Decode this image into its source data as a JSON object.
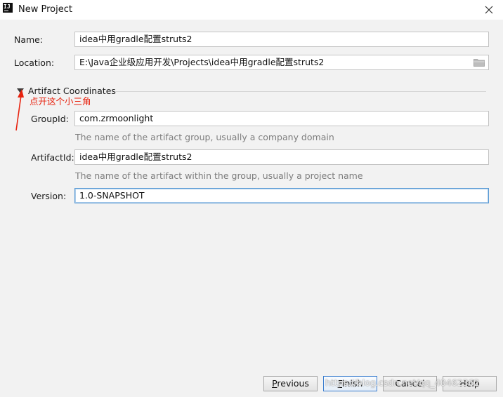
{
  "window": {
    "title": "New Project",
    "app_icon_text": "IJ"
  },
  "name": {
    "label": "Name:",
    "value": "idea中用gradle配置struts2"
  },
  "location": {
    "label": "Location:",
    "value": "E:\\Java企业级应用开发\\Projects\\idea中用gradle配置struts2"
  },
  "artifact": {
    "title": "Artifact Coordinates",
    "group_id": {
      "label": "GroupId:",
      "value": "com.zrmoonlight",
      "hint": "The name of the artifact group, usually a company domain"
    },
    "artifact_id": {
      "label": "ArtifactId:",
      "value": "idea中用gradle配置struts2",
      "hint": "The name of the artifact within the group, usually a project name"
    },
    "version": {
      "label": "Version:",
      "value": "1.0-SNAPSHOT"
    }
  },
  "annotation": {
    "text": "点开这个小三角",
    "color": "#e8230f"
  },
  "buttons": {
    "previous": {
      "mnemonic": "P",
      "rest": "revious"
    },
    "finish": {
      "mnemonic": "F",
      "rest": "inish"
    },
    "cancel": {
      "label": "Cancel"
    },
    "help": {
      "label": "Help"
    }
  },
  "watermark": "https://blog.csdn.net/qq_40462362",
  "icons": [
    "app-logo-icon",
    "close-icon",
    "folder-icon",
    "expand-triangle-icon",
    "annotation-arrow-icon"
  ],
  "colors": {
    "focus_border": "#5b9bd5",
    "default_button_border": "#3d7fcf",
    "annotation_red": "#e8230f"
  }
}
